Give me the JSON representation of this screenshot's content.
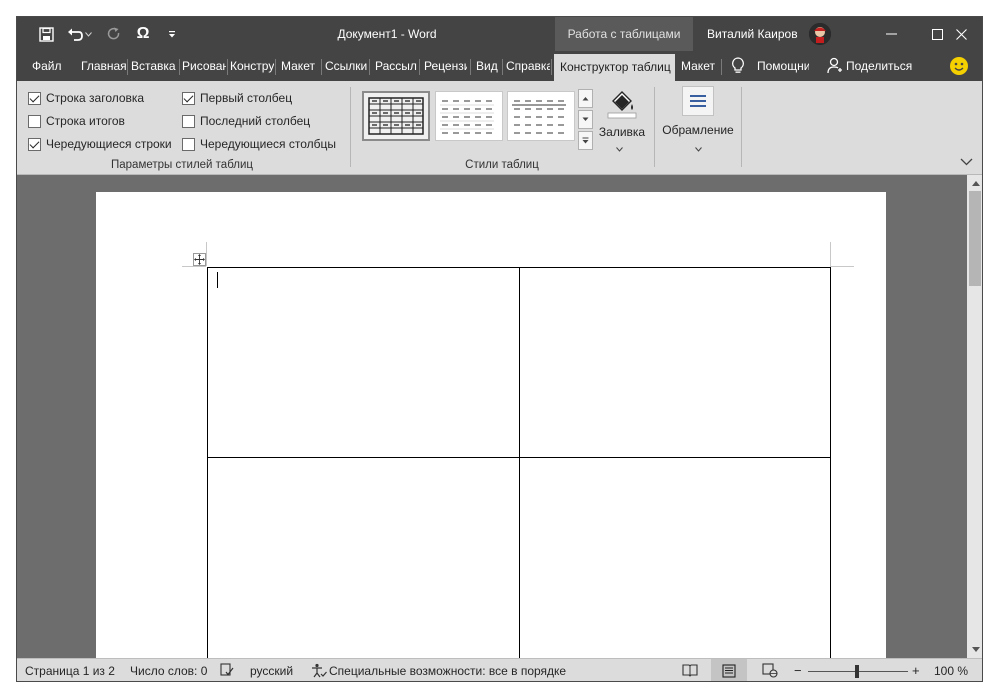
{
  "window": {
    "doc_title": "Документ1  -  Word",
    "context_tab": "Работа с таблицами",
    "user_name": "Виталий Каиров"
  },
  "tabs": [
    {
      "label": "Файл"
    },
    {
      "label": "Главная"
    },
    {
      "label": "Вставка"
    },
    {
      "label": "Рисование"
    },
    {
      "label": "Конструктор"
    },
    {
      "label": "Макет"
    },
    {
      "label": "Ссылки"
    },
    {
      "label": "Рассылки"
    },
    {
      "label": "Рецензирование"
    },
    {
      "label": "Вид"
    },
    {
      "label": "Справка"
    },
    {
      "label": "Конструктор таблиц"
    },
    {
      "label": "Макет"
    }
  ],
  "tell_me": "Помощник",
  "share": "Поделиться",
  "ribbon": {
    "options": {
      "header_row": "Строка заголовка",
      "total_row": "Строка итогов",
      "banded_rows": "Чередующиеся строки",
      "first_column": "Первый столбец",
      "last_column": "Последний столбец",
      "banded_columns": "Чередующиеся столбцы",
      "group_label": "Параметры стилей таблиц",
      "checked": {
        "header_row": true,
        "total_row": false,
        "banded_rows": true,
        "first_column": true,
        "last_column": false,
        "banded_columns": false
      }
    },
    "styles": {
      "group_label": "Стили таблиц",
      "fill_label": "Заливка",
      "borders_label": "Обрамление"
    }
  },
  "status": {
    "page": "Страница 1 из 2",
    "words": "Число слов: 0",
    "language": "русский",
    "accessibility": "Специальные возможности: все в порядке",
    "zoom": "100 %"
  }
}
